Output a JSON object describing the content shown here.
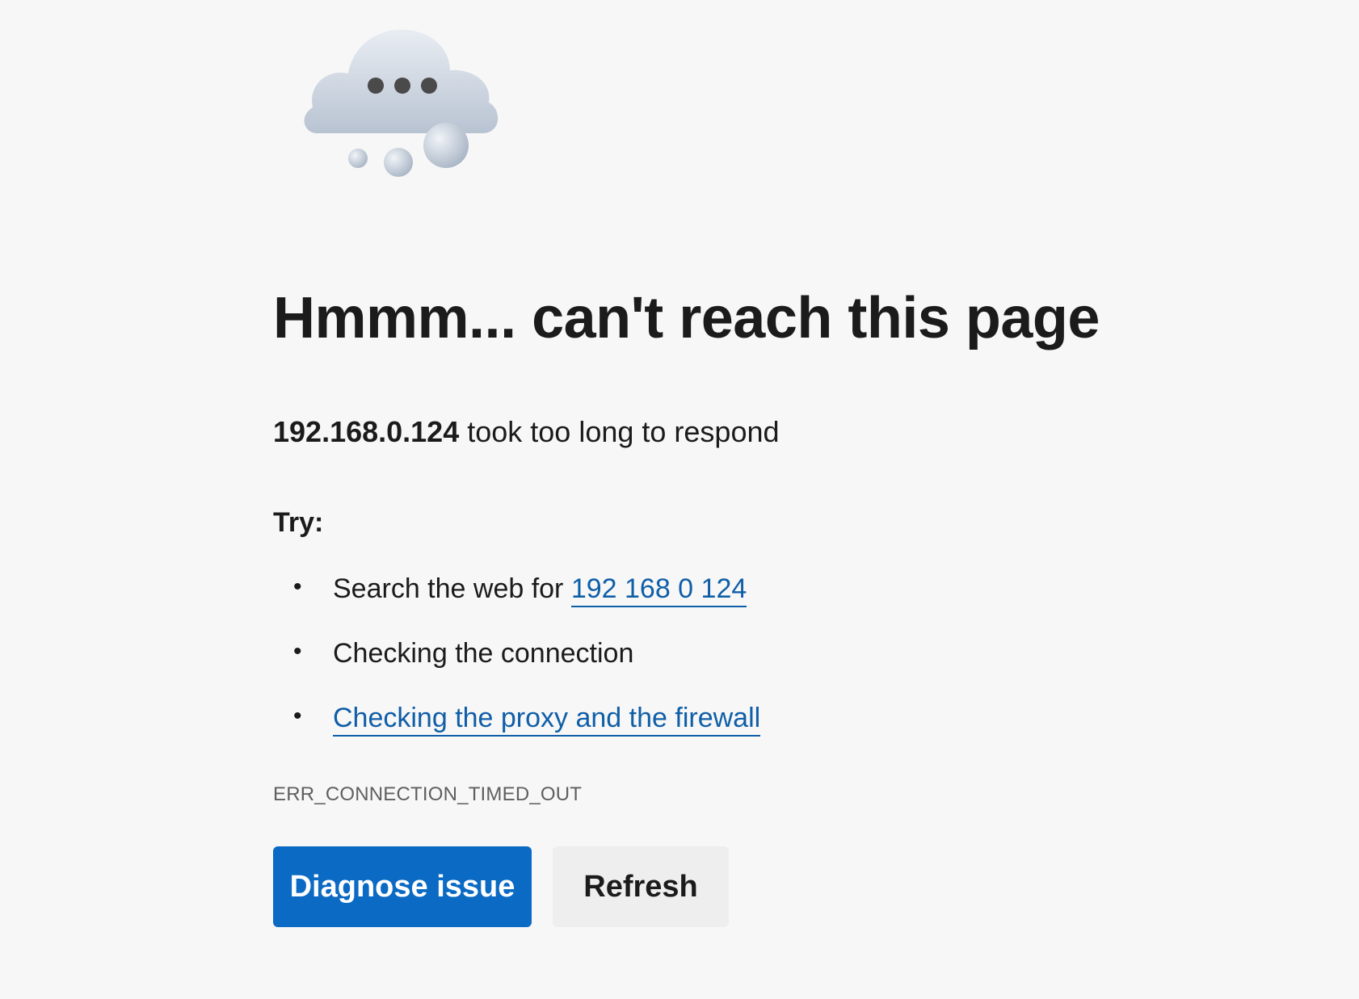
{
  "colors": {
    "background": "#f7f7f7",
    "text": "#1b1b1b",
    "link": "#0f5ea8",
    "primary_button": "#0a6ac4",
    "secondary_button": "#eeeeee",
    "error_code": "#5f5f5f"
  },
  "illustration": {
    "icon": "thinking-cloud-icon"
  },
  "title": "Hmmm... can't reach this page",
  "subtitle": {
    "host": "192.168.0.124",
    "message": " took too long to respond"
  },
  "try_heading": "Try:",
  "suggestions": [
    {
      "prefix": "Search the web for ",
      "link": "192 168 0 124"
    },
    {
      "text": "Checking the connection"
    },
    {
      "link": "Checking the proxy and the firewall"
    }
  ],
  "bullet": "•",
  "error_code": "ERR_CONNECTION_TIMED_OUT",
  "buttons": {
    "diagnose": "Diagnose issue",
    "refresh": "Refresh"
  }
}
